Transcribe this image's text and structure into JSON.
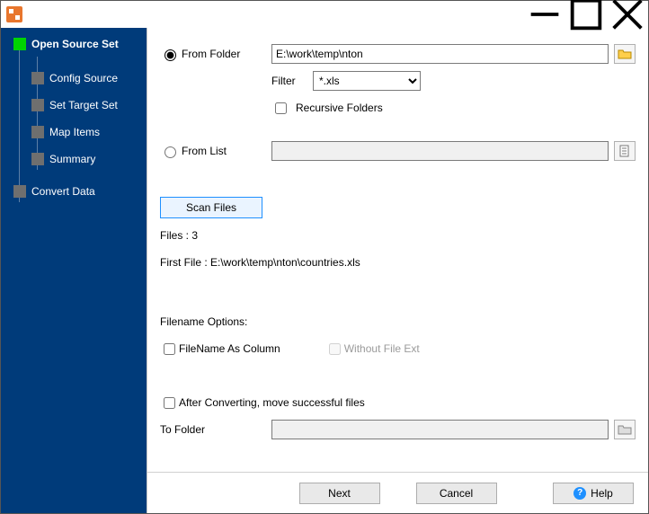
{
  "titlebar": {
    "title": ""
  },
  "sidebar": {
    "items": [
      {
        "label": "Open Source Set"
      },
      {
        "label": "Config Source"
      },
      {
        "label": "Set Target Set"
      },
      {
        "label": "Map Items"
      },
      {
        "label": "Summary"
      },
      {
        "label": "Convert Data"
      }
    ]
  },
  "form": {
    "from_folder_label": "From Folder",
    "folder_path": "E:\\work\\temp\\nton",
    "filter_label": "Filter",
    "filter_value": "*.xls",
    "recursive_label": "Recursive Folders",
    "from_list_label": "From List",
    "from_list_value": "",
    "scan_button": "Scan Files",
    "files_count_line": "Files : 3",
    "first_file_line": "First File : E:\\work\\temp\\nton\\countries.xls",
    "filename_options_label": "Filename Options:",
    "filename_as_column_label": "FileName As Column",
    "without_ext_label": "Without File Ext",
    "after_convert_label": "After Converting, move successful files",
    "to_folder_label": "To Folder",
    "to_folder_value": ""
  },
  "footer": {
    "next": "Next",
    "cancel": "Cancel",
    "help": "Help"
  }
}
